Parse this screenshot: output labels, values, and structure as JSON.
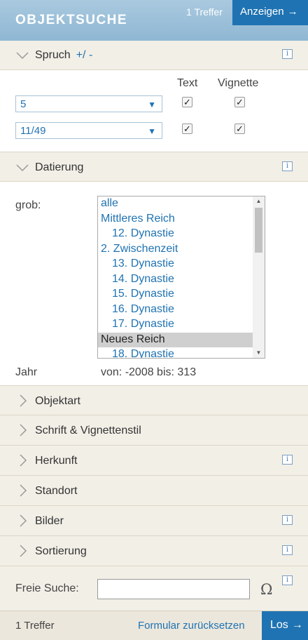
{
  "header": {
    "title": "OBJEKTSUCHE",
    "hits": "1 Treffer",
    "show_button": "Anzeigen"
  },
  "spruch": {
    "label": "Spruch",
    "plus_minus": "+/ -",
    "col_text": "Text",
    "col_vignette": "Vignette",
    "rows": [
      {
        "value": "5",
        "text_checked": true,
        "vignette_checked": true
      },
      {
        "value": "11/49",
        "text_checked": true,
        "vignette_checked": true
      }
    ]
  },
  "datierung": {
    "label": "Datierung",
    "grob_label": "grob:",
    "list": [
      {
        "text": "alle",
        "indent": false,
        "selected": false
      },
      {
        "text": "Mittleres Reich",
        "indent": false,
        "selected": false
      },
      {
        "text": "12. Dynastie",
        "indent": true,
        "selected": false
      },
      {
        "text": "2. Zwischenzeit",
        "indent": false,
        "selected": false
      },
      {
        "text": "13. Dynastie",
        "indent": true,
        "selected": false
      },
      {
        "text": "14. Dynastie",
        "indent": true,
        "selected": false
      },
      {
        "text": "15. Dynastie",
        "indent": true,
        "selected": false
      },
      {
        "text": "16. Dynastie",
        "indent": true,
        "selected": false
      },
      {
        "text": "17. Dynastie",
        "indent": true,
        "selected": false
      },
      {
        "text": "Neues Reich",
        "indent": false,
        "selected": true
      },
      {
        "text": "18. Dynastie",
        "indent": true,
        "selected": false
      }
    ],
    "jahr_label": "Jahr",
    "jahr_range": "von: -2008 bis: 313"
  },
  "sections": {
    "objektart": "Objektart",
    "schrift": "Schrift & Vignettenstil",
    "herkunft": "Herkunft",
    "standort": "Standort",
    "bilder": "Bilder",
    "sortierung": "Sortierung"
  },
  "free_search": {
    "label": "Freie Suche:",
    "value": "",
    "special_chars": "Ω"
  },
  "info_icon": "i",
  "footer": {
    "hits": "1 Treffer",
    "reset": "Formular zurücksetzen",
    "go_button": "Los"
  },
  "colors": {
    "accent": "#1f73b2",
    "header_bg": "#9cc0da",
    "section_bg": "#f2efe7"
  },
  "icons": {
    "arrow": "arrow-right-icon",
    "collapse": "chevron-down-icon",
    "expand": "chevron-right-icon"
  }
}
